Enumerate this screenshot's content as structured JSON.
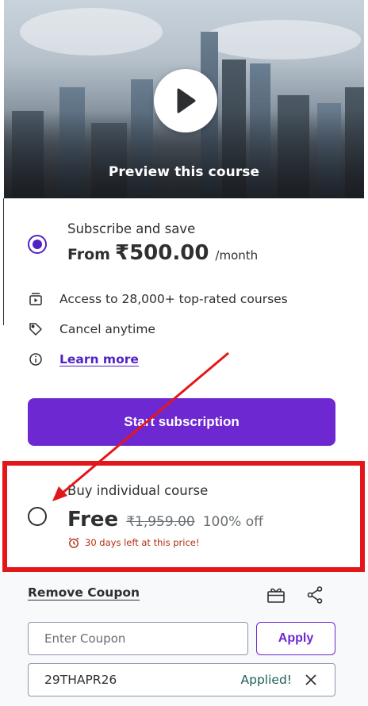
{
  "preview": {
    "label": "Preview this course"
  },
  "subscription": {
    "title": "Subscribe and save",
    "price_from": "From",
    "price_amount": "₹500.00",
    "price_period": "/month",
    "selected": true,
    "features": [
      {
        "icon": "video-library-icon",
        "text": "Access to 28,000+ top-rated courses"
      },
      {
        "icon": "tag-icon",
        "text": "Cancel anytime"
      },
      {
        "icon": "info-icon",
        "text": "Learn more",
        "is_link": true
      }
    ],
    "cta_label": "Start subscription"
  },
  "individual": {
    "title": "Buy individual course",
    "price": "Free",
    "original_price": "₹1,959.00",
    "discount": "100% off",
    "timer_text": "30 days left at this price!",
    "selected": false
  },
  "coupon": {
    "remove_label": "Remove Coupon",
    "input_placeholder": "Enter Coupon",
    "apply_label": "Apply",
    "applied_code": "29THAPR26",
    "applied_status": "Applied!"
  },
  "colors": {
    "accent": "#6d28d2",
    "radio_selected": "#5022c3",
    "highlight_box": "#e3171a",
    "applied_green": "#1e6055",
    "timer_red": "#b32d0f"
  }
}
